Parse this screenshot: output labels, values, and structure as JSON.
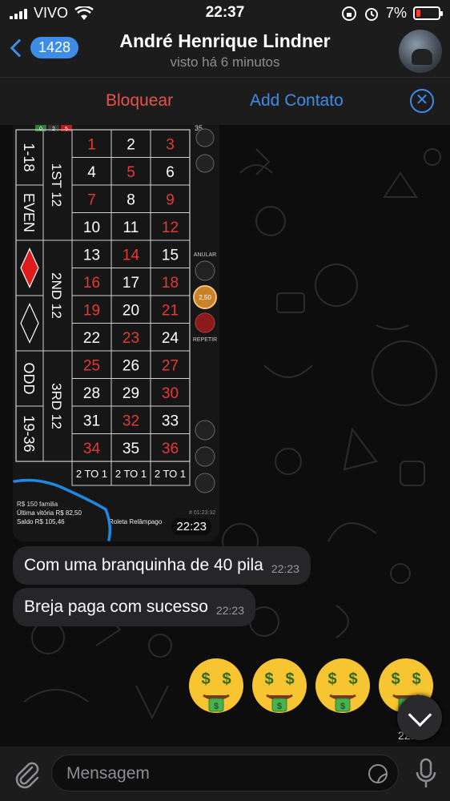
{
  "status_bar": {
    "carrier": "VIVO",
    "time": "22:37",
    "battery": "7%"
  },
  "header": {
    "back_count": "1428",
    "title": "André Henrique Lindner",
    "subtitle": "visto há 6 minutos"
  },
  "actions": {
    "block": "Bloquear",
    "add_contact": "Add Contato"
  },
  "roulette": {
    "top_chips": [
      "0",
      "2",
      "5"
    ],
    "side_labels": [
      "1-18",
      "EVEN",
      "ODD",
      "19-36"
    ],
    "dozens": [
      "1ST 12",
      "2ND 12",
      "3RD 12"
    ],
    "rows": [
      [
        "1",
        "2",
        "3"
      ],
      [
        "4",
        "5",
        "6"
      ],
      [
        "7",
        "8",
        "9"
      ],
      [
        "10",
        "11",
        "12"
      ],
      [
        "13",
        "14",
        "15"
      ],
      [
        "16",
        "17",
        "18"
      ],
      [
        "19",
        "20",
        "21"
      ],
      [
        "22",
        "23",
        "24"
      ],
      [
        "25",
        "26",
        "27"
      ],
      [
        "28",
        "29",
        "30"
      ],
      [
        "31",
        "32",
        "33"
      ],
      [
        "34",
        "35",
        "36"
      ]
    ],
    "red_numbers": [
      "1",
      "3",
      "5",
      "7",
      "9",
      "12",
      "14",
      "16",
      "18",
      "19",
      "21",
      "23",
      "25",
      "27",
      "30",
      "32",
      "34",
      "36"
    ],
    "columns": [
      "2 TO 1",
      "2 TO 1",
      "2 TO 1"
    ],
    "right_top_number": "35",
    "cancel_label": "ANULAR",
    "chip_value": "2,50",
    "repeat_label": "REPETIR",
    "info_lines": [
      "R$ 150 familia",
      "Última vitória R$ 82,50",
      "Saldo R$ 105,46"
    ],
    "game_name": "Roleta Relâmpago",
    "game_id": "# 01:23:32"
  },
  "photo_time": "22:23",
  "messages": [
    {
      "text": "Com uma branquinha de 40 pila",
      "time": "22:23"
    },
    {
      "text": "Breja paga com sucesso",
      "time": "22:23"
    }
  ],
  "emoji_message": {
    "emoji": "money-mouth-face",
    "count": 4,
    "time": "22:24"
  },
  "input": {
    "placeholder": "Mensagem"
  }
}
